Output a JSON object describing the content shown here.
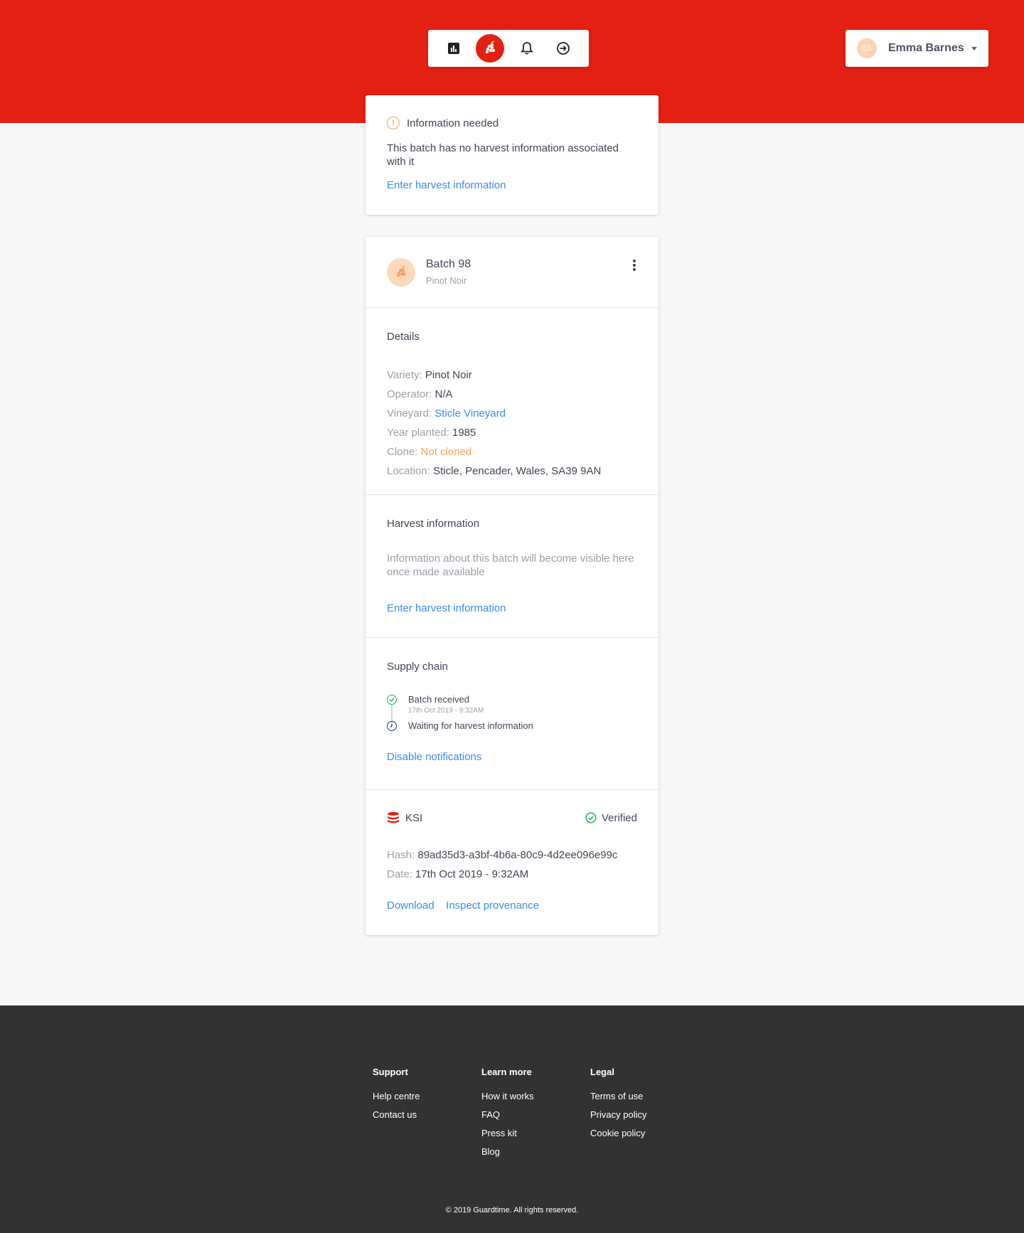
{
  "nav": {
    "items": [
      {
        "icon": "bar-chart-icon",
        "active": false
      },
      {
        "icon": "grapes-icon",
        "active": true
      },
      {
        "icon": "bell-icon",
        "active": false
      },
      {
        "icon": "logout-icon",
        "active": false
      }
    ]
  },
  "user": {
    "initials": "EB",
    "name": "Emma Barnes"
  },
  "alert": {
    "title": "Information needed",
    "body": "This batch has no harvest information associated with it",
    "link": "Enter harvest information"
  },
  "batch": {
    "title": "Batch 98",
    "subtitle": "Pinot Noir",
    "details": {
      "title": "Details",
      "variety_label": "Variety:",
      "variety": "Pinot Noir",
      "operator_label": "Operator:",
      "operator": "N/A",
      "vineyard_label": "Vineyard:",
      "vineyard": "Sticle Vineyard",
      "year_label": "Year planted:",
      "year": "1985",
      "clone_label": "Clone:",
      "clone": "Not cloned",
      "location_label": "Location:",
      "location": "Sticle, Pencader, Wales, SA39 9AN"
    },
    "harvest": {
      "title": "Harvest information",
      "message": "Information about this batch will become visible here once made available",
      "link": "Enter harvest information"
    },
    "supply": {
      "title": "Supply chain",
      "events": [
        {
          "label": "Batch received",
          "time": "17th Oct 2019 - 9:32AM"
        },
        {
          "label": "Waiting for harvest information",
          "time": ""
        }
      ],
      "link": "Disable notifications"
    },
    "ksi": {
      "name": "KSI",
      "status": "Verified",
      "hash_label": "Hash:",
      "hash": "89ad35d3-a3bf-4b6a-80c9-4d2ee096e99c",
      "date_label": "Date:",
      "date": "17th Oct 2019 - 9:32AM",
      "download": "Download",
      "inspect": "Inspect provenance"
    }
  },
  "footer": {
    "support": {
      "title": "Support",
      "links": [
        "Help centre",
        "Contact us"
      ]
    },
    "learn": {
      "title": "Learn more",
      "links": [
        "How it works",
        "FAQ",
        "Press kit",
        "Blog"
      ]
    },
    "legal": {
      "title": "Legal",
      "links": [
        "Terms of use",
        "Privacy policy",
        "Cookie policy"
      ]
    },
    "copyright": "© 2019 Guardtime. All rights reserved."
  },
  "colors": {
    "brand_red": "#e32012",
    "link_blue": "#3b8be8",
    "warning_orange": "#f5a15e",
    "success_green": "#27ae60"
  }
}
